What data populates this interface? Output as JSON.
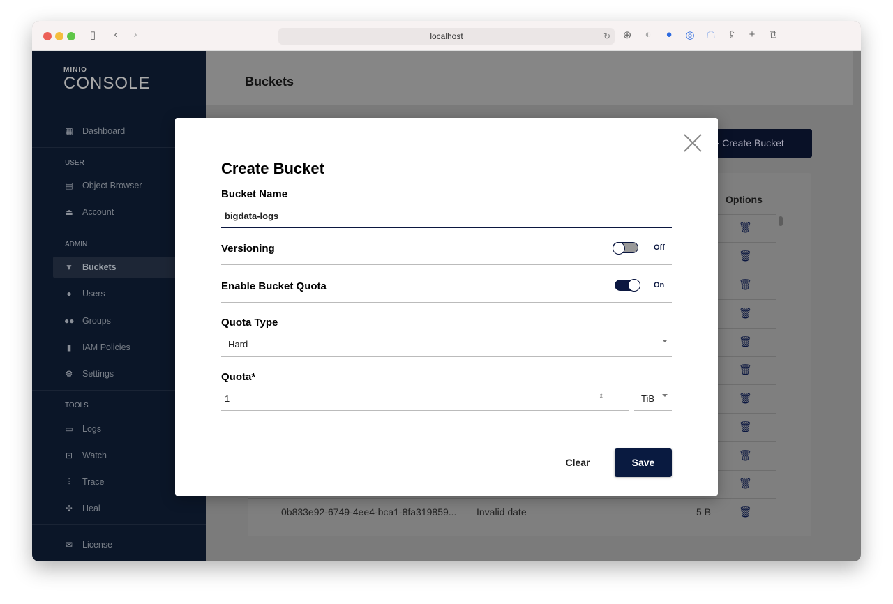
{
  "browser": {
    "url": "localhost"
  },
  "sidebar": {
    "logo_small": "MINIO",
    "logo_big": "CONSOLE",
    "sections": {
      "user": "USER",
      "admin": "ADMIN",
      "tools": "TOOLS"
    },
    "items": [
      {
        "label": "Dashboard",
        "icon": "dashboard-icon"
      },
      {
        "label": "Object Browser",
        "icon": "file-icon"
      },
      {
        "label": "Account",
        "icon": "bell-icon"
      },
      {
        "label": "Buckets",
        "icon": "bucket-icon",
        "active": true
      },
      {
        "label": "Users",
        "icon": "user-icon"
      },
      {
        "label": "Groups",
        "icon": "groups-icon"
      },
      {
        "label": "IAM Policies",
        "icon": "bookmark-icon"
      },
      {
        "label": "Settings",
        "icon": "settings-icon"
      },
      {
        "label": "Logs",
        "icon": "logs-icon"
      },
      {
        "label": "Watch",
        "icon": "watch-icon"
      },
      {
        "label": "Trace",
        "icon": "trace-icon"
      },
      {
        "label": "Heal",
        "icon": "heal-icon"
      },
      {
        "label": "License",
        "icon": "license-icon"
      }
    ]
  },
  "page": {
    "title": "Buckets",
    "create_button": "Create Bucket",
    "options_header": "Options",
    "last_row": {
      "name": "0b833e92-6749-4ee4-bca1-8fa319859...",
      "date": "Invalid date",
      "size": "5 B"
    }
  },
  "modal": {
    "title": "Create Bucket",
    "bucket_name_label": "Bucket Name",
    "bucket_name_value": "bigdata-logs",
    "versioning_label": "Versioning",
    "versioning_state": "Off",
    "quota_enable_label": "Enable Bucket Quota",
    "quota_enable_state": "On",
    "quota_type_label": "Quota Type",
    "quota_type_value": "Hard",
    "quota_label": "Quota*",
    "quota_value": "1",
    "quota_unit": "TiB",
    "clear_button": "Clear",
    "save_button": "Save"
  },
  "colors": {
    "accent": "#091a40",
    "sidebar": "#0b1628"
  }
}
